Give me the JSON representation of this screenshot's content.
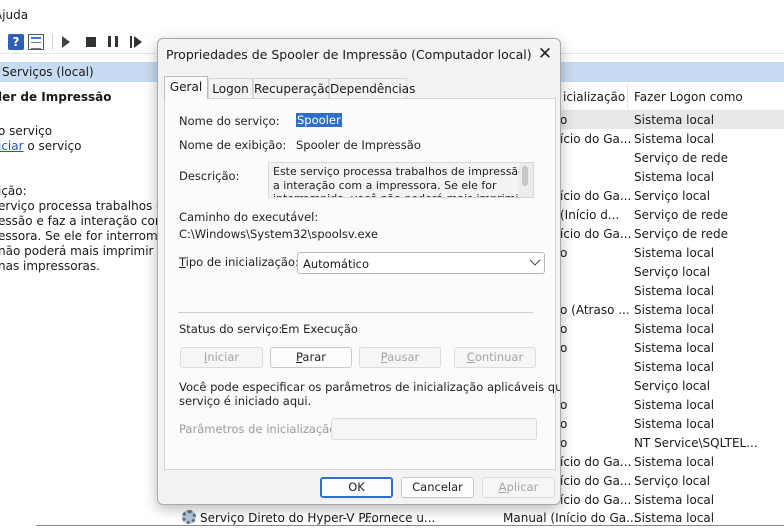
{
  "background": {
    "menu": {
      "item": "Ajuda"
    },
    "tree_header": "Serviços (local)",
    "left_pane": {
      "title": "ler de Impressão",
      "link_stop_rest": "o serviço",
      "link_restart_prefix": "iciar",
      "link_restart_rest": " o serviço",
      "description_label": "ição:",
      "description": "erviço processa trabalhos de\nessão e faz a interação com a\nessora. Se ele for interrompido,\nnão poderá mais imprimir ou\nnas impressoras."
    },
    "columns": {
      "startup_type": "icialização",
      "logon_as": "Fazer Logon como"
    },
    "rows": [
      {
        "startup": "o",
        "logon": "Sistema local",
        "selected": true
      },
      {
        "startup": "ício do Ga...",
        "logon": "Sistema local"
      },
      {
        "startup": "",
        "logon": "Serviço de rede"
      },
      {
        "startup": "",
        "logon": "Sistema local"
      },
      {
        "startup": "ício do Ga...",
        "logon": "Serviço local"
      },
      {
        "startup": "(Início d...",
        "logon": "Serviço de rede"
      },
      {
        "startup": "ício do Ga...",
        "logon": "Serviço de rede"
      },
      {
        "startup": "o",
        "logon": "Sistema local"
      },
      {
        "startup": "",
        "logon": "Serviço local"
      },
      {
        "startup": "",
        "logon": "Sistema local"
      },
      {
        "startup": "o (Atraso ...",
        "logon": "Sistema local"
      },
      {
        "startup": "o",
        "logon": "Sistema local"
      },
      {
        "startup": "o",
        "logon": "Sistema local"
      },
      {
        "startup": "",
        "logon": "Sistema local"
      },
      {
        "startup": "",
        "logon": "Serviço local"
      },
      {
        "startup": "o",
        "logon": "Sistema local"
      },
      {
        "startup": "o",
        "logon": "Sistema local"
      },
      {
        "startup": "o",
        "logon": "NT Service\\SQLTEL..."
      },
      {
        "startup": "ício do Ga...",
        "logon": "Sistema local"
      },
      {
        "startup": "ício do Ga...",
        "logon": "Serviço local"
      },
      {
        "startup": "ício do Ga...",
        "logon": "Sistema local"
      }
    ],
    "bottom_row": {
      "name": "Serviço Direto do Hyper-V P...",
      "description": "Fornece u...",
      "startup": "Manual (Início do Ga...",
      "logon": "Sistema local"
    }
  },
  "dialog": {
    "title": "Propriedades de Spooler de Impressão (Computador local)",
    "tabs": [
      "Geral",
      "Logon",
      "Recuperação",
      "Dependências"
    ],
    "service_name_label": "Nome do serviço:",
    "service_name": "Spooler",
    "display_name_label": "Nome de exibição:",
    "display_name": "Spooler de Impressão",
    "description_label": "Descrição:",
    "description": "Este serviço processa trabalhos de impressão e faz\na interação com a impressora. Se ele for\ninterrompido, você não poderá mais imprimir ou ver",
    "path_label": "Caminho do executável:",
    "path": "C:\\Windows\\System32\\spoolsv.exe",
    "startup_type_label_prefix": "T",
    "startup_type_label_rest": "ipo de inicialização:",
    "startup_type": "Automático",
    "status_label": "Status do serviço:",
    "status": "Em Execução",
    "buttons": {
      "start_u": "I",
      "start_rest": "niciar",
      "stop_u": "P",
      "stop_rest": "arar",
      "pause_u": "P",
      "pause_rest": "ausar",
      "continue_u": "C",
      "continue_rest": "ontinuar"
    },
    "hint": "Você pode especificar os parâmetros de inicialização aplicáveis quando o\nserviço é iniciado aqui.",
    "params_label": "Parâmetros de inicialização:",
    "params_value": "",
    "ok": "OK",
    "cancel": "Cancelar",
    "apply_u": "A",
    "apply_rest": "plicar"
  }
}
